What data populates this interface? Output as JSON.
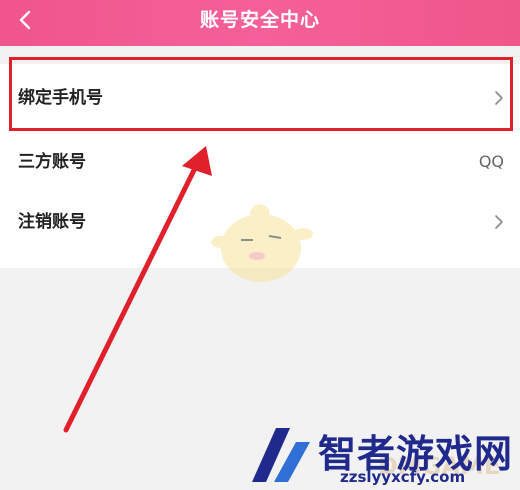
{
  "header": {
    "title": "账号安全中心",
    "back_icon": "chevron-left-icon"
  },
  "rows": [
    {
      "label": "绑定手机号",
      "value": "",
      "icon": "chevron-right-icon"
    },
    {
      "label": "三方账号",
      "value": "QQ"
    },
    {
      "label": "注销账号",
      "value": "",
      "icon": "chevron-right-icon"
    }
  ],
  "annotation": {
    "color": "#e0202a"
  },
  "watermark": {
    "title": "智者游戏网",
    "url": "zzslyyxcfy.com",
    "faint": "DMGAME"
  },
  "colors": {
    "header": "#f0558c",
    "background": "#f2f2f2",
    "list_bg": "#ffffff"
  }
}
